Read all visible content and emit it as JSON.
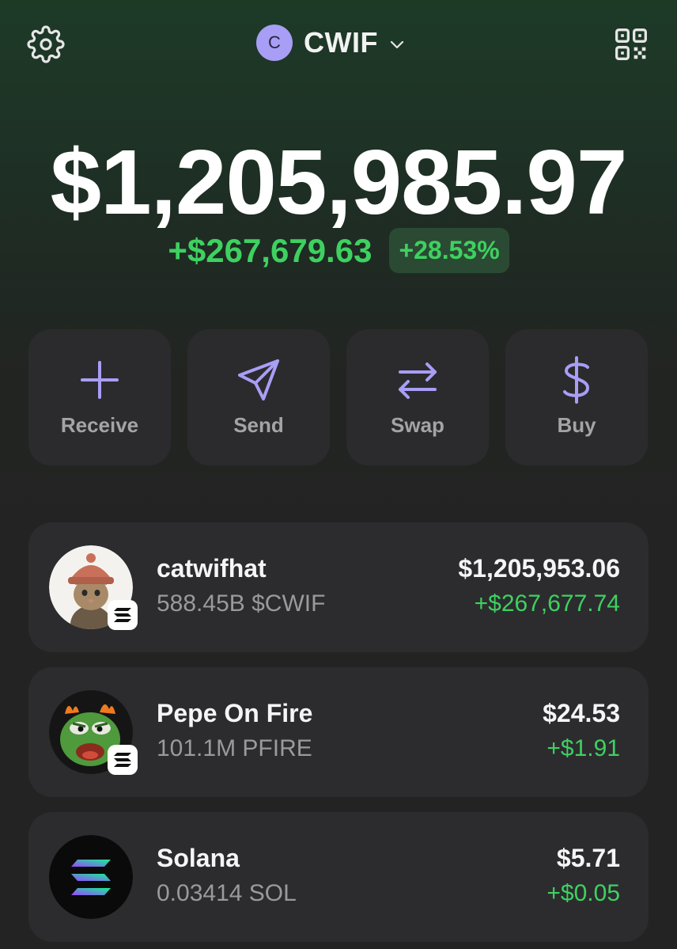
{
  "header": {
    "account_initial": "C",
    "account_name": "CWIF",
    "icons": [
      "gear-icon",
      "chevron-down-icon",
      "qr-code-icon"
    ]
  },
  "balance": {
    "total": "$1,205,985.97",
    "change_amount": "+$267,679.63",
    "change_percent": "+28.53%"
  },
  "actions": [
    {
      "label": "Receive",
      "icon": "plus-icon"
    },
    {
      "label": "Send",
      "icon": "send-icon"
    },
    {
      "label": "Swap",
      "icon": "swap-icon"
    },
    {
      "label": "Buy",
      "icon": "dollar-icon"
    }
  ],
  "tokens": [
    {
      "name": "catwifhat",
      "quantity": "588.45B $CWIF",
      "value": "$1,205,953.06",
      "change": "+$267,677.74",
      "logo": "cat-with-hat-logo"
    },
    {
      "name": "Pepe On Fire",
      "quantity": "101.1M PFIRE",
      "value": "$24.53",
      "change": "+$1.91",
      "logo": "pepe-fire-logo"
    },
    {
      "name": "Solana",
      "quantity": "0.03414 SOL",
      "value": "$5.71",
      "change": "+$0.05",
      "logo": "solana-logo"
    }
  ],
  "colors": {
    "accent": "#a89ef5",
    "positive": "#3ed160",
    "card": "#2c2c2f"
  }
}
